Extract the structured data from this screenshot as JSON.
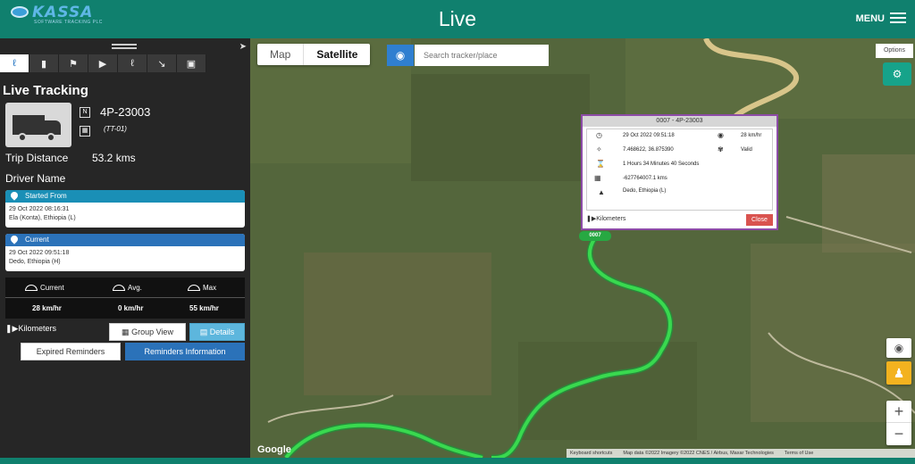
{
  "header": {
    "brand": "KASSA",
    "brand_sub": "SOFTWARE TRACKING PLC",
    "title": "Live",
    "menu_label": "MENU"
  },
  "sidebar": {
    "title": "Live Tracking",
    "vehicle_id": "4P-23003",
    "vehicle_code": "(TT-01)",
    "trip_distance_label": "Trip Distance",
    "trip_distance_value": "53.2 kms",
    "driver_label": "Driver Name",
    "started": {
      "header": "Started From",
      "time": "29 Oct 2022 08:16:31",
      "place": "Ela (Konta), Ethiopia (L)"
    },
    "current": {
      "header": "Current",
      "time": "29 Oct 2022 09:51:18",
      "place": "Dedo, Ethiopia (H)"
    },
    "speeds": {
      "current_label": "Current",
      "avg_label": "Avg.",
      "max_label": "Max",
      "current_value": "28 km/hr",
      "avg_value": "0 km/hr",
      "max_value": "55 km/hr"
    },
    "kilometers_label": "Kilometers",
    "group_view_label": "Group View",
    "details_label": "Details",
    "expired_label": "Expired Reminders",
    "reminders_label": "Reminders Information"
  },
  "map": {
    "tab_map": "Map",
    "tab_satellite": "Satellite",
    "search_placeholder": "Search tracker/place",
    "options_label": "Options",
    "vehicle_tag": "0007",
    "google": "Google",
    "attrib_shortcuts": "Keyboard shortcuts",
    "attrib_data": "Map data ©2022 Imagery ©2022 CNES / Airbus, Maxar Technologies",
    "attrib_terms": "Terms of Use",
    "zoom_in": "+",
    "zoom_out": "−"
  },
  "popup": {
    "title": "0007 - 4P-23003",
    "time": "29 Oct 2022 09:51:18",
    "speed": "28 km/hr",
    "coords": "7.468622, 36.875390",
    "gps_status": "Valid",
    "duration": "1 Hours 34 Minutes 40 Seconds",
    "odometer": "-627764007.1 kms",
    "location": "Dedo, Ethiopia (L)",
    "kilometers": "Kilometers",
    "close": "Close"
  },
  "colors": {
    "header": "#10806e",
    "started": "#1a8fb6",
    "current": "#2b72b9",
    "route": "#33c14a"
  }
}
